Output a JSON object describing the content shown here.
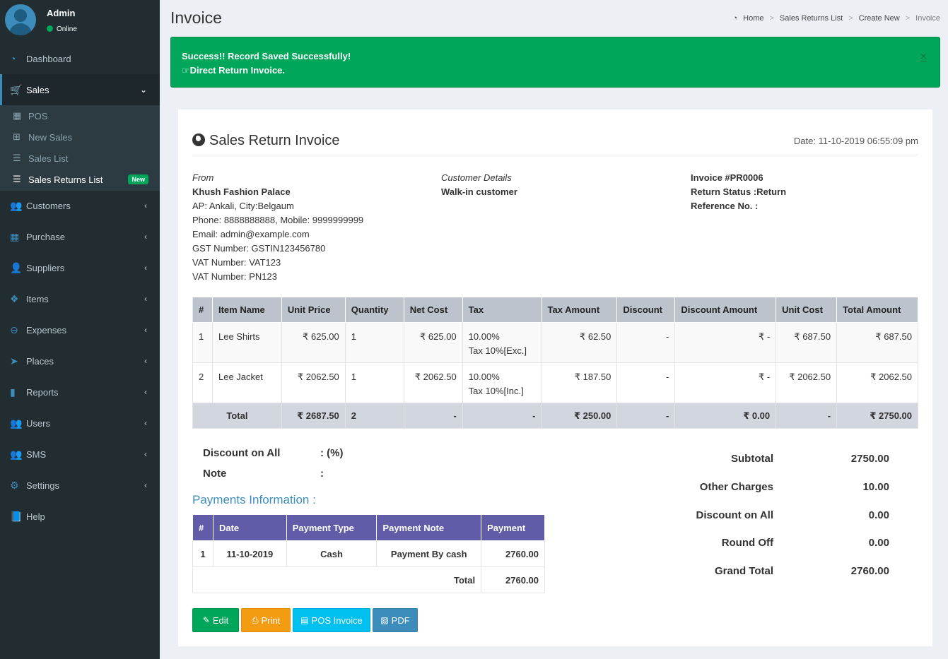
{
  "user": {
    "name": "Admin",
    "status": "Online"
  },
  "sidebar": {
    "items": [
      {
        "label": "Dashboard",
        "icon": "dashboard-icon"
      },
      {
        "label": "Sales",
        "icon": "cart-icon"
      },
      {
        "label": "Customers",
        "icon": "users-icon"
      },
      {
        "label": "Purchase",
        "icon": "grid-icon"
      },
      {
        "label": "Suppliers",
        "icon": "user-plus-icon"
      },
      {
        "label": "Items",
        "icon": "cubes-icon"
      },
      {
        "label": "Expenses",
        "icon": "minus-circle-icon"
      },
      {
        "label": "Places",
        "icon": "paper-plane-icon"
      },
      {
        "label": "Reports",
        "icon": "bar-chart-icon"
      },
      {
        "label": "Users",
        "icon": "users-icon"
      },
      {
        "label": "SMS",
        "icon": "users-icon"
      },
      {
        "label": "Settings",
        "icon": "cogs-icon"
      },
      {
        "label": "Help",
        "icon": "book-icon"
      }
    ],
    "sales_sub": [
      {
        "label": "POS"
      },
      {
        "label": "New Sales"
      },
      {
        "label": "Sales List"
      },
      {
        "label": "Sales Returns List",
        "badge": "New"
      }
    ]
  },
  "header": {
    "title": "Invoice",
    "breadcrumb": [
      "Home",
      "Sales Returns List",
      "Create New",
      "Invoice"
    ]
  },
  "alert": {
    "line1": "Success!! Record Saved Successfully!",
    "line2": "Direct Return Invoice.",
    "close": "×"
  },
  "invoice": {
    "title": "Sales Return Invoice",
    "date": "Date: 11-10-2019 06:55:09 pm",
    "from": {
      "label": "From",
      "name": "Khush Fashion Palace",
      "address": "AP: Ankali, City:Belgaum",
      "phone": "Phone: 8888888888, Mobile: 9999999999",
      "email": "Email: admin@example.com",
      "gst": "GST Number: GSTIN123456780",
      "vat1": "VAT Number: VAT123",
      "vat2": "VAT Number: PN123"
    },
    "customer": {
      "label": "Customer Details",
      "name": "Walk-in customer"
    },
    "meta": {
      "number": "Invoice #PR0006",
      "status": "Return Status :Return",
      "reference": "Reference No. :"
    },
    "columns": [
      "#",
      "Item Name",
      "Unit Price",
      "Quantity",
      "Net Cost",
      "Tax",
      "Tax Amount",
      "Discount",
      "Discount Amount",
      "Unit Cost",
      "Total Amount"
    ],
    "rows": [
      [
        "1",
        "Lee Shirts",
        "₹ 625.00",
        "1",
        "₹ 625.00",
        "10.00%",
        "Tax 10%[Exc.]",
        "₹ 62.50",
        "-",
        "₹ -",
        "₹ 687.50",
        "₹ 687.50"
      ],
      [
        "2",
        "Lee Jacket",
        "₹ 2062.50",
        "1",
        "₹ 2062.50",
        "10.00%",
        "Tax 10%[Inc.]",
        "₹ 187.50",
        "-",
        "₹ -",
        "₹ 2062.50",
        "₹ 2062.50"
      ]
    ],
    "total_row": [
      "Total",
      "₹ 2687.50",
      "2",
      "-",
      "-",
      "₹ 250.00",
      "-",
      "₹ 0.00",
      "-",
      "₹ 2750.00"
    ],
    "discount_on_all": {
      "label": "Discount on All",
      "value": ": (%)"
    },
    "note": {
      "label": "Note",
      "value": ":"
    }
  },
  "payments": {
    "title": "Payments Information :",
    "columns": [
      "#",
      "Date",
      "Payment Type",
      "Payment Note",
      "Payment"
    ],
    "rows": [
      [
        "1",
        "11-10-2019",
        "Cash",
        "Payment By cash",
        "2760.00"
      ]
    ],
    "total_label": "Total",
    "total_value": "2760.00"
  },
  "summary": [
    {
      "label": "Subtotal",
      "value": "2750.00"
    },
    {
      "label": "Other Charges",
      "value": "10.00"
    },
    {
      "label": "Discount on All",
      "value": "0.00"
    },
    {
      "label": "Round Off",
      "value": "0.00"
    },
    {
      "label": "Grand Total",
      "value": "2760.00"
    }
  ],
  "buttons": {
    "edit": "Edit",
    "print": "Print",
    "pos_invoice": "POS Invoice",
    "pdf": "PDF"
  },
  "colors": {
    "sidebar_bg": "#222d32",
    "accent": "#3c8dbc",
    "success": "#00a65a",
    "print": "#f39c12",
    "pos": "#00c0ef",
    "pdf": "#3c8dbc",
    "payments_header": "#605ca8"
  }
}
